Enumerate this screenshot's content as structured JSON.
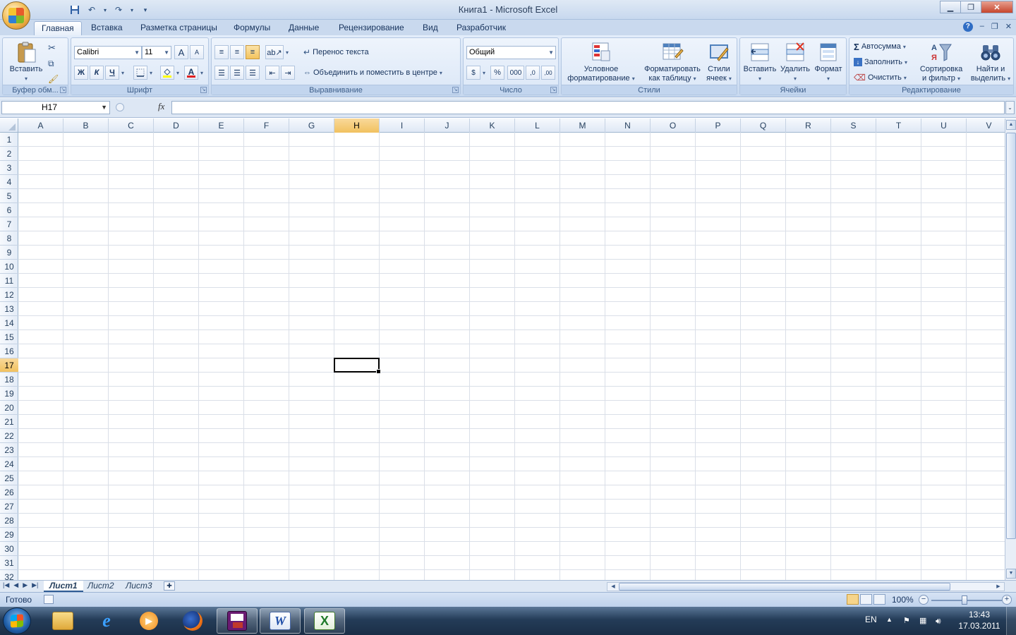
{
  "window": {
    "title": "Книга1 - Microsoft Excel"
  },
  "ribbon": {
    "tabs": [
      "Главная",
      "Вставка",
      "Разметка страницы",
      "Формулы",
      "Данные",
      "Рецензирование",
      "Вид",
      "Разработчик"
    ],
    "active_tab": "Главная",
    "clipboard": {
      "label": "Буфер обм...",
      "paste": "Вставить"
    },
    "font": {
      "label": "Шрифт",
      "name": "Calibri",
      "size": "11",
      "bold": "Ж",
      "italic": "К",
      "underline": "Ч",
      "grow": "A",
      "shrink": "A",
      "font_color_glyph": "A"
    },
    "alignment": {
      "label": "Выравнивание",
      "wrap": "Перенос текста",
      "merge": "Объединить и поместить в центре"
    },
    "number": {
      "label": "Число",
      "format": "Общий",
      "percent": "%",
      "thousands": "000",
      "inc_decimal": ",0",
      "dec_decimal": ",00"
    },
    "styles": {
      "label": "Стили",
      "conditional": [
        "Условное",
        "форматирование"
      ],
      "as_table": [
        "Форматировать",
        "как таблицу"
      ],
      "cell_styles": [
        "Стили",
        "ячеек"
      ]
    },
    "cells": {
      "label": "Ячейки",
      "insert": "Вставить",
      "delete": "Удалить",
      "format": "Формат"
    },
    "editing": {
      "label": "Редактирование",
      "autosum": "Автосумма",
      "fill": "Заполнить",
      "clear": "Очистить",
      "sort": [
        "Сортировка",
        "и фильтр"
      ],
      "find": [
        "Найти и",
        "выделить"
      ]
    }
  },
  "formula_bar": {
    "name_box": "H17",
    "fx": "fx",
    "value": ""
  },
  "grid": {
    "columns": [
      "A",
      "B",
      "C",
      "D",
      "E",
      "F",
      "G",
      "H",
      "I",
      "J",
      "K",
      "L",
      "M",
      "N",
      "O",
      "P",
      "Q",
      "R",
      "S",
      "T",
      "U",
      "V"
    ],
    "rows": [
      "1",
      "2",
      "3",
      "4",
      "5",
      "6",
      "7",
      "8",
      "9",
      "10",
      "11",
      "12",
      "13",
      "14",
      "15",
      "16",
      "17",
      "18",
      "19",
      "20",
      "21",
      "22",
      "23",
      "24",
      "25",
      "26",
      "27",
      "28",
      "29",
      "30",
      "31",
      "32"
    ],
    "selected_column": "H",
    "selected_row": "17"
  },
  "sheets": {
    "tabs": [
      "Лист1",
      "Лист2",
      "Лист3"
    ],
    "active": "Лист1"
  },
  "status": {
    "text": "Готово",
    "zoom": "100%"
  },
  "taskbar": {
    "lang": "EN",
    "time": "13:43",
    "date": "17.03.2011"
  }
}
